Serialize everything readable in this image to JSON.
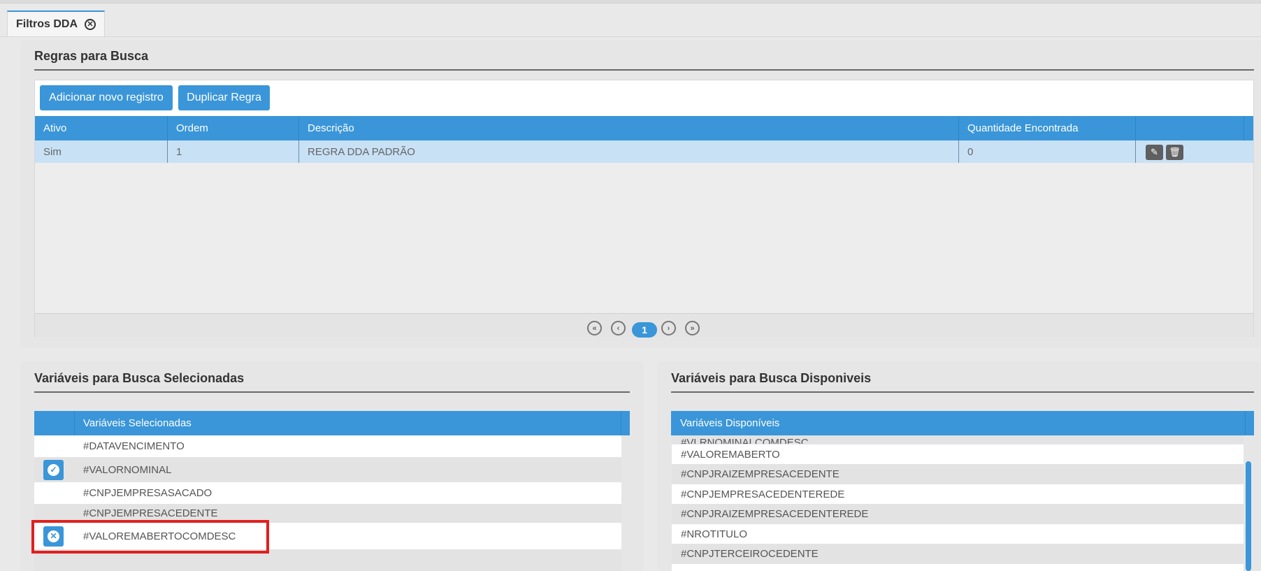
{
  "tab": {
    "label": "Filtros DDA",
    "close_icon": "close-circle-icon"
  },
  "rules": {
    "title": "Regras para Busca",
    "add_button": "Adicionar novo registro",
    "duplicate_button": "Duplicar Regra",
    "columns": [
      "Ativo",
      "Ordem",
      "Descrição",
      "Quantidade Encontrada"
    ],
    "rows": [
      {
        "ativo": "Sim",
        "ordem": "1",
        "descricao": "REGRA DDA PADRÃO",
        "quantidade": "0"
      }
    ],
    "pager": {
      "current": "1"
    }
  },
  "selected": {
    "title": "Variáveis para Busca Selecionadas",
    "header": "Variáveis Selecionadas",
    "items": [
      "#DATAVENCIMENTO",
      "#VALORNOMINAL",
      "#CNPJEMPRESASACADO",
      "#CNPJEMPRESACEDENTE",
      "#VALOREMABERTOCOMDESC"
    ]
  },
  "available": {
    "title": "Variáveis para Busca Disponiveis",
    "header": "Variáveis Disponíveis",
    "items": [
      "#VLRNOMINALCOMDESC",
      "#VALOREMABERTO",
      "#CNPJRAIZEMPRESACEDENTE",
      "#CNPJEMPRESACEDENTEREDE",
      "#CNPJRAIZEMPRESACEDENTEREDE",
      "#NROTITULO",
      "#CNPJTERCEIROCEDENTE"
    ]
  },
  "colors": {
    "accent": "#3a96d8",
    "highlight": "#e02020",
    "row_selected": "#c8e1f5"
  }
}
